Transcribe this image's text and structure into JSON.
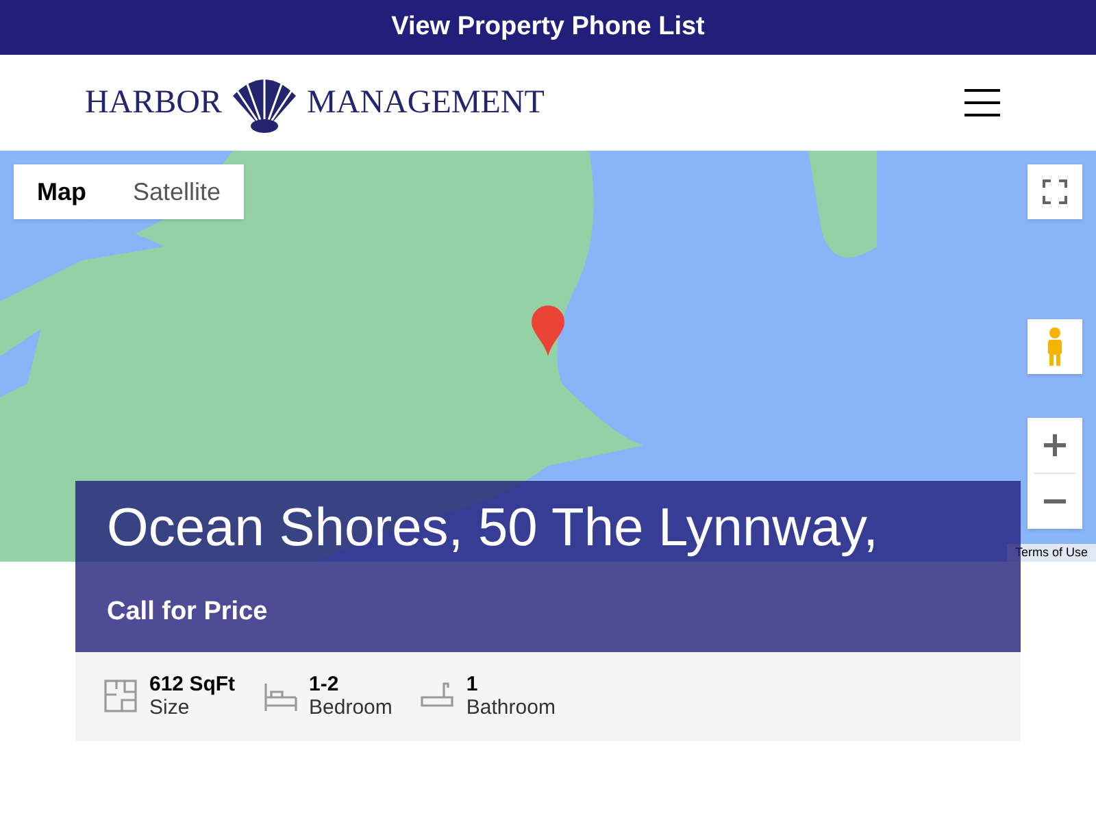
{
  "banner": {
    "label": "View Property Phone List"
  },
  "logo": {
    "left": "HARBOR",
    "right": "MANAGEMENT"
  },
  "map": {
    "types": [
      {
        "label": "Map",
        "selected": true
      },
      {
        "label": "Satellite",
        "selected": false
      }
    ],
    "terms": "Terms of Use"
  },
  "property": {
    "title": "Ocean Shores, 50 The Lynnway,",
    "price": "Call for Price",
    "stats": [
      {
        "kind": "size",
        "value": "612 SqFt",
        "label": "Size"
      },
      {
        "kind": "bedroom",
        "value": "1-2",
        "label": "Bedroom"
      },
      {
        "kind": "bathroom",
        "value": "1",
        "label": "Bathroom"
      }
    ]
  }
}
